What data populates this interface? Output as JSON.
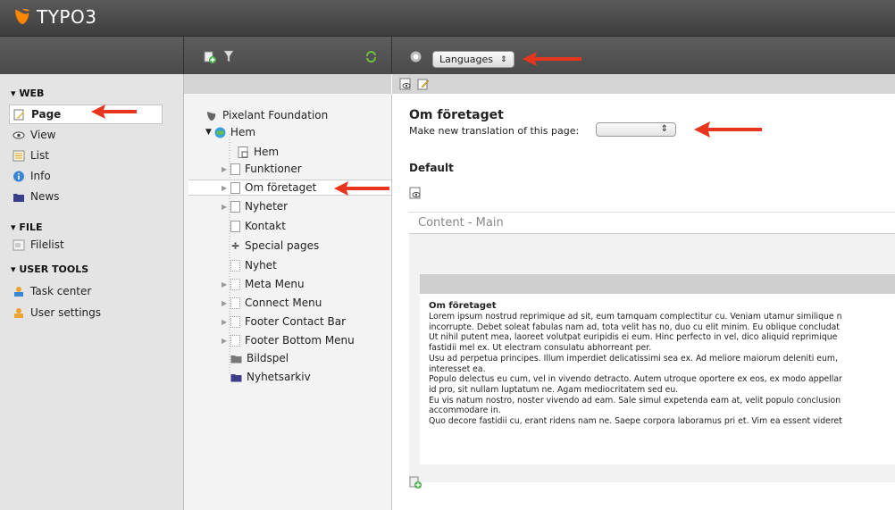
{
  "app": {
    "logo_text": "TYPO3",
    "brand_color": "#ff8700"
  },
  "left_nav": {
    "sections": [
      {
        "title": "▾ WEB",
        "items": [
          {
            "label": "Page",
            "icon": "page-edit-icon",
            "active": true
          },
          {
            "label": "View",
            "icon": "eye-icon"
          },
          {
            "label": "List",
            "icon": "list-icon"
          },
          {
            "label": "Info",
            "icon": "info-icon"
          },
          {
            "label": "News",
            "icon": "folder-icon"
          }
        ]
      },
      {
        "title": "▾ FILE",
        "items": [
          {
            "label": "Filelist",
            "icon": "filelist-icon"
          }
        ]
      },
      {
        "title": "▾ USER TOOLS",
        "items": [
          {
            "label": "Task center",
            "icon": "task-center-icon"
          },
          {
            "label": "User settings",
            "icon": "user-settings-icon"
          }
        ]
      }
    ]
  },
  "page_tree": {
    "root": "Pixelant Foundation",
    "home": "Hem",
    "children": [
      "Hem",
      "Funktioner",
      "Om företaget",
      "Nyheter",
      "Kontakt",
      "Special pages",
      "Nyhet",
      "Meta Menu",
      "Connect Menu",
      "Footer Contact Bar",
      "Footer Bottom Menu",
      "Bildspel",
      "Nyhetsarkiv"
    ]
  },
  "toolbar": {
    "languages_label": "Languages",
    "languages_caret": "⇕"
  },
  "content": {
    "page_title": "Om företaget",
    "translation_label": "Make new translation of this page:",
    "translation_caret": "⇕",
    "default_heading": "Default",
    "column_title": "Content - Main",
    "element_title": "Om företaget",
    "element_lines": [
      "Lorem ipsum nostrud reprimique ad sit, eum tamquam complectitur cu. Veniam utamur similique n",
      "incorrupte. Debet soleat fabulas nam ad, tota velit has no, duo cu elit minim. Eu oblique concludat",
      "Ut nihil putent mea, laoreet volutpat euripidis ei eum. Hinc perfecto in vel, dico aliquid reprimique",
      "fastidii mel ex. Ut electram consulatu abhorreant per.",
      "Usu ad perpetua principes. Illum imperdiet delicatissimi sea ex. Ad meliore maiorum deleniti eum,",
      "interesset ea.",
      "Populo delectus eu cum, vel in vivendo detracto. Autem utroque oportere ex eos, ex modo appellar",
      "id pro, sit nullam luptatum ne. Agam mediocritatem sed eu.",
      "Eu vis natum nostro, noster vivendo ad eam. Sale simul expetenda eam at, velit populo conclusion",
      "accommodare in.",
      "Quo decore fastidii cu, erant ridens nam ne. Saepe corpora laboramus pri et. Vim ea essent videret"
    ]
  },
  "annotation_color": "#e8351e"
}
